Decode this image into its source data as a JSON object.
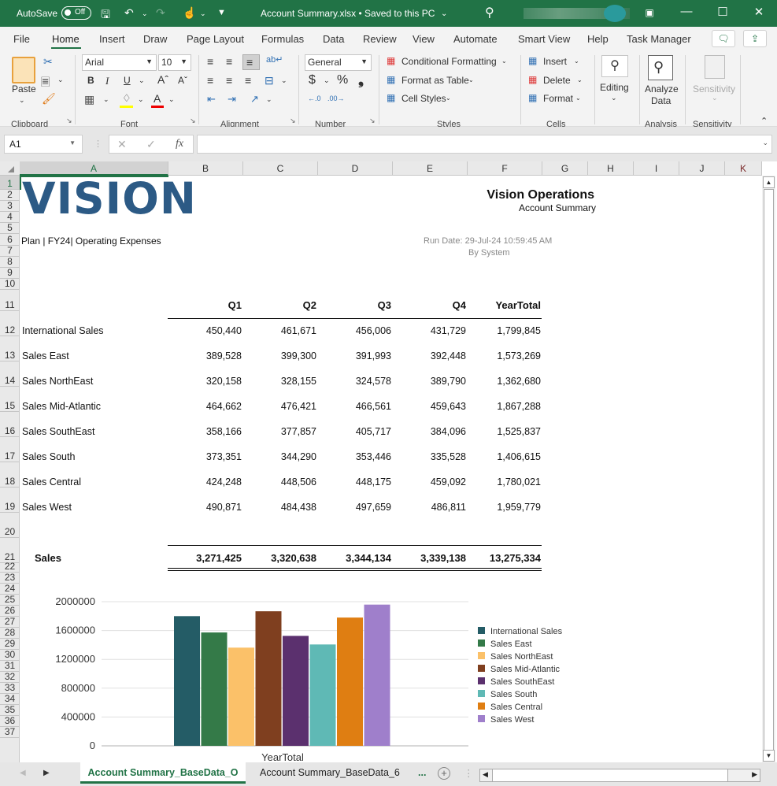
{
  "titlebar": {
    "autosave_label": "AutoSave",
    "autosave_state": "Off",
    "document_title": "Account Summary.xlsx • Saved to this PC",
    "colors": {
      "excel_green": "#217346"
    }
  },
  "menu": {
    "tabs": [
      "File",
      "Home",
      "Insert",
      "Draw",
      "Page Layout",
      "Formulas",
      "Data",
      "Review",
      "View",
      "Automate",
      "Smart View",
      "Help",
      "Task Manager"
    ],
    "active_tab": "Home"
  },
  "ribbon": {
    "clipboard": {
      "paste_label": "Paste",
      "group_label": "Clipboard"
    },
    "font": {
      "font_name": "Arial",
      "font_size": "10",
      "group_label": "Font",
      "bold": "B",
      "italic": "I",
      "underline": "U"
    },
    "alignment": {
      "group_label": "Alignment"
    },
    "number": {
      "format": "General",
      "group_label": "Number",
      "currency": "$",
      "percent": "%",
      "comma": "❟"
    },
    "styles": {
      "conditional_formatting": "Conditional Formatting",
      "format_as_table": "Format as Table",
      "cell_styles": "Cell Styles",
      "group_label": "Styles"
    },
    "cells": {
      "insert": "Insert",
      "delete": "Delete",
      "format": "Format",
      "group_label": "Cells"
    },
    "editing": {
      "label": "Editing"
    },
    "analysis": {
      "label_line1": "Analyze",
      "label_line2": "Data",
      "group_label": "Analysis"
    },
    "sensitivity": {
      "label": "Sensitivity",
      "group_label": "Sensitivity"
    }
  },
  "formula_bar": {
    "name_box": "A1",
    "fx": "fx",
    "formula": ""
  },
  "grid": {
    "columns": [
      "A",
      "B",
      "C",
      "D",
      "E",
      "F",
      "G",
      "H",
      "I",
      "J",
      "K"
    ],
    "selected_column": "A",
    "rows": [
      "1",
      "2",
      "3",
      "4",
      "5",
      "6",
      "7",
      "8",
      "9",
      "10",
      "11",
      "12",
      "13",
      "14",
      "15",
      "16",
      "17",
      "18",
      "19",
      "20",
      "21",
      "22",
      "23",
      "24",
      "25",
      "26",
      "27",
      "28",
      "29",
      "30",
      "31",
      "32",
      "33",
      "34",
      "35",
      "36",
      "37"
    ]
  },
  "report": {
    "logo_text": "VISION",
    "company": "Vision Operations",
    "report_name": "Account Summary",
    "pov": "Plan | FY24| Operating Expenses",
    "run_date": "Run Date:  29-Jul-24  10:59:45  AM",
    "run_by": "By  System",
    "headers": [
      "Q1",
      "Q2",
      "Q3",
      "Q4",
      "YearTotal"
    ],
    "rows": [
      {
        "label": "International Sales",
        "values": [
          "450,440",
          "461,671",
          "456,006",
          "431,729",
          "1,799,845"
        ]
      },
      {
        "label": "Sales East",
        "values": [
          "389,528",
          "399,300",
          "391,993",
          "392,448",
          "1,573,269"
        ]
      },
      {
        "label": "Sales NorthEast",
        "values": [
          "320,158",
          "328,155",
          "324,578",
          "389,790",
          "1,362,680"
        ]
      },
      {
        "label": "Sales Mid-Atlantic",
        "values": [
          "464,662",
          "476,421",
          "466,561",
          "459,643",
          "1,867,288"
        ]
      },
      {
        "label": "Sales SouthEast",
        "values": [
          "358,166",
          "377,857",
          "405,717",
          "384,096",
          "1,525,837"
        ]
      },
      {
        "label": "Sales South",
        "values": [
          "373,351",
          "344,290",
          "353,446",
          "335,528",
          "1,406,615"
        ]
      },
      {
        "label": "Sales Central",
        "values": [
          "424,248",
          "448,506",
          "448,175",
          "459,092",
          "1,780,021"
        ]
      },
      {
        "label": "Sales West",
        "values": [
          "490,871",
          "484,438",
          "497,659",
          "486,811",
          "1,959,779"
        ]
      }
    ],
    "total": {
      "label": "Sales",
      "values": [
        "3,271,425",
        "3,320,638",
        "3,344,134",
        "3,339,138",
        "13,275,334"
      ]
    }
  },
  "chart_data": {
    "type": "bar",
    "title": "",
    "xlabel": "",
    "ylabel": "",
    "categories": [
      "YearTotal"
    ],
    "ylim": [
      0,
      2000000
    ],
    "yticks": [
      0,
      400000,
      800000,
      1200000,
      1600000,
      2000000
    ],
    "grid": true,
    "legend": "right",
    "series": [
      {
        "name": "International Sales",
        "values": [
          1799845
        ],
        "color": "#245c66"
      },
      {
        "name": "Sales East",
        "values": [
          1573269
        ],
        "color": "#347a48"
      },
      {
        "name": "Sales NorthEast",
        "values": [
          1362680
        ],
        "color": "#fbc169"
      },
      {
        "name": "Sales Mid-Atlantic",
        "values": [
          1867288
        ],
        "color": "#7f3f1f"
      },
      {
        "name": "Sales SouthEast",
        "values": [
          1525837
        ],
        "color": "#5b306e"
      },
      {
        "name": "Sales South",
        "values": [
          1406615
        ],
        "color": "#5fb9b5"
      },
      {
        "name": "Sales Central",
        "values": [
          1780021
        ],
        "color": "#df7e12"
      },
      {
        "name": "Sales West",
        "values": [
          1959779
        ],
        "color": "#9f7fcb"
      }
    ]
  },
  "sheet_tabs": {
    "tabs": [
      "Account Summary_BaseData_O",
      "Account Summary_BaseData_6"
    ],
    "active": "Account Summary_BaseData_O",
    "more": "...",
    "add": "+"
  }
}
